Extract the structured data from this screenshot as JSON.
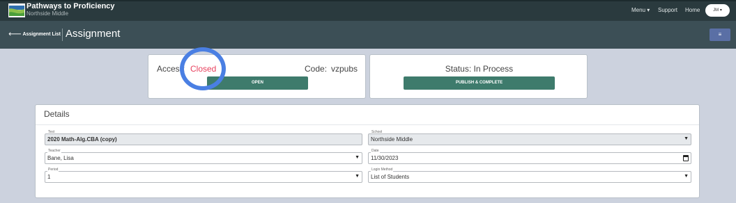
{
  "app": {
    "name": "Pathways to Proficiency",
    "school": "Northside Middle",
    "logo_icon": "map-logo-icon"
  },
  "nav": {
    "menu": "Menu ▾",
    "support": "Support",
    "home": "Home",
    "user_initials": "JM ▾"
  },
  "header": {
    "back_link": "🡐 Assignment List",
    "title": "Assignment",
    "toggle_icon": "≡"
  },
  "access_card": {
    "label": "Access",
    "value": "Closed",
    "code_label": "Code:",
    "code_value": "vzpubs",
    "open_button": "OPEN"
  },
  "status_card": {
    "status_text": "Status: In Process",
    "publish_button": "PUBLISH & COMPLETE"
  },
  "details": {
    "title": "Details",
    "test": {
      "label": "Test",
      "value": "2020 Math-Alg.CBA (copy)"
    },
    "teacher": {
      "label": "Teacher",
      "value": "Bane, Lisa"
    },
    "period": {
      "label": "Period",
      "value": "1"
    },
    "school": {
      "label": "School",
      "value": "Northside Middle"
    },
    "date": {
      "label": "Date",
      "value": "11/30/2023"
    },
    "login_method": {
      "label": "Login Method",
      "value": "List of Students"
    }
  },
  "colors": {
    "topbar": "#2a3a3e",
    "subheader": "#3c4f56",
    "teal_button": "#3e7b6c",
    "closed_red": "#e8415e",
    "highlight_blue": "#4a7fe3",
    "background": "#ccd2de"
  }
}
